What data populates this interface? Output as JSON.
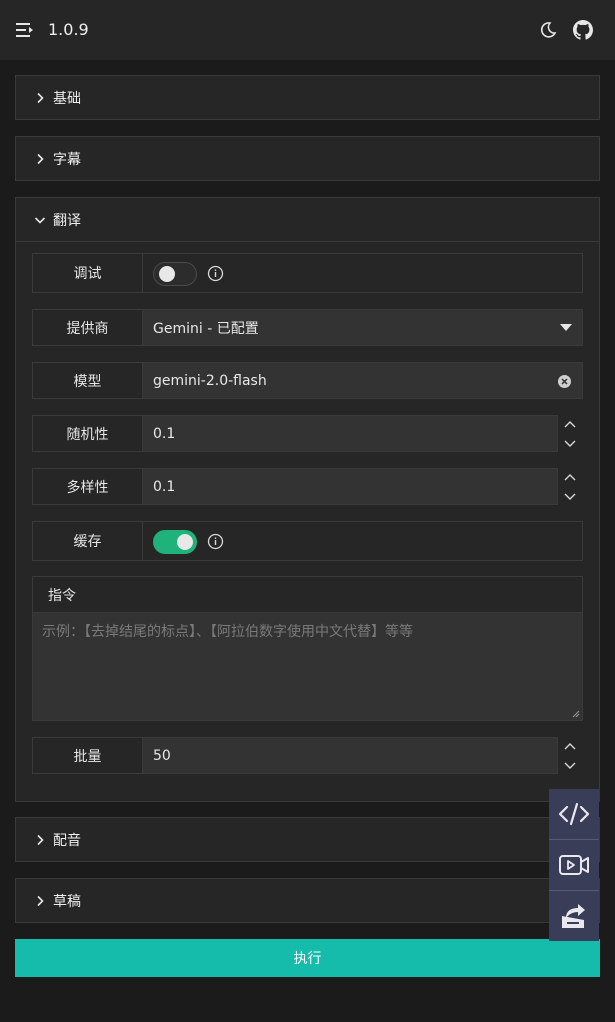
{
  "header": {
    "version": "1.0.9",
    "icons": [
      "menu-icon",
      "moon-icon",
      "github-icon"
    ]
  },
  "sections": {
    "basic": {
      "title": "基础",
      "expanded": false
    },
    "subtitle": {
      "title": "字幕",
      "expanded": false
    },
    "translate": {
      "title": "翻译",
      "expanded": true
    },
    "dubbing": {
      "title": "配音",
      "expanded": false
    },
    "draft": {
      "title": "草稿",
      "expanded": false
    }
  },
  "translate": {
    "debug": {
      "label": "调试",
      "enabled": false
    },
    "provider": {
      "label": "提供商",
      "value": "Gemini - 已配置"
    },
    "model": {
      "label": "模型",
      "value": "gemini-2.0-flash"
    },
    "temperature": {
      "label": "随机性",
      "value": "0.1"
    },
    "top_p": {
      "label": "多样性",
      "value": "0.1"
    },
    "cache": {
      "label": "缓存",
      "enabled": true
    },
    "instruction": {
      "label": "指令",
      "placeholder": "示例：【去掉结尾的标点】、【阿拉伯数字使用中文代替】等等"
    },
    "batch": {
      "label": "批量",
      "value": "50"
    }
  },
  "actions": {
    "run_label": "执行"
  },
  "side_tools": [
    "code-icon",
    "video-icon",
    "export-icon"
  ],
  "colors": {
    "accent": "#15bcab",
    "toggle_on": "#1fb27a",
    "side_tools_bg": "#3a3d57"
  }
}
